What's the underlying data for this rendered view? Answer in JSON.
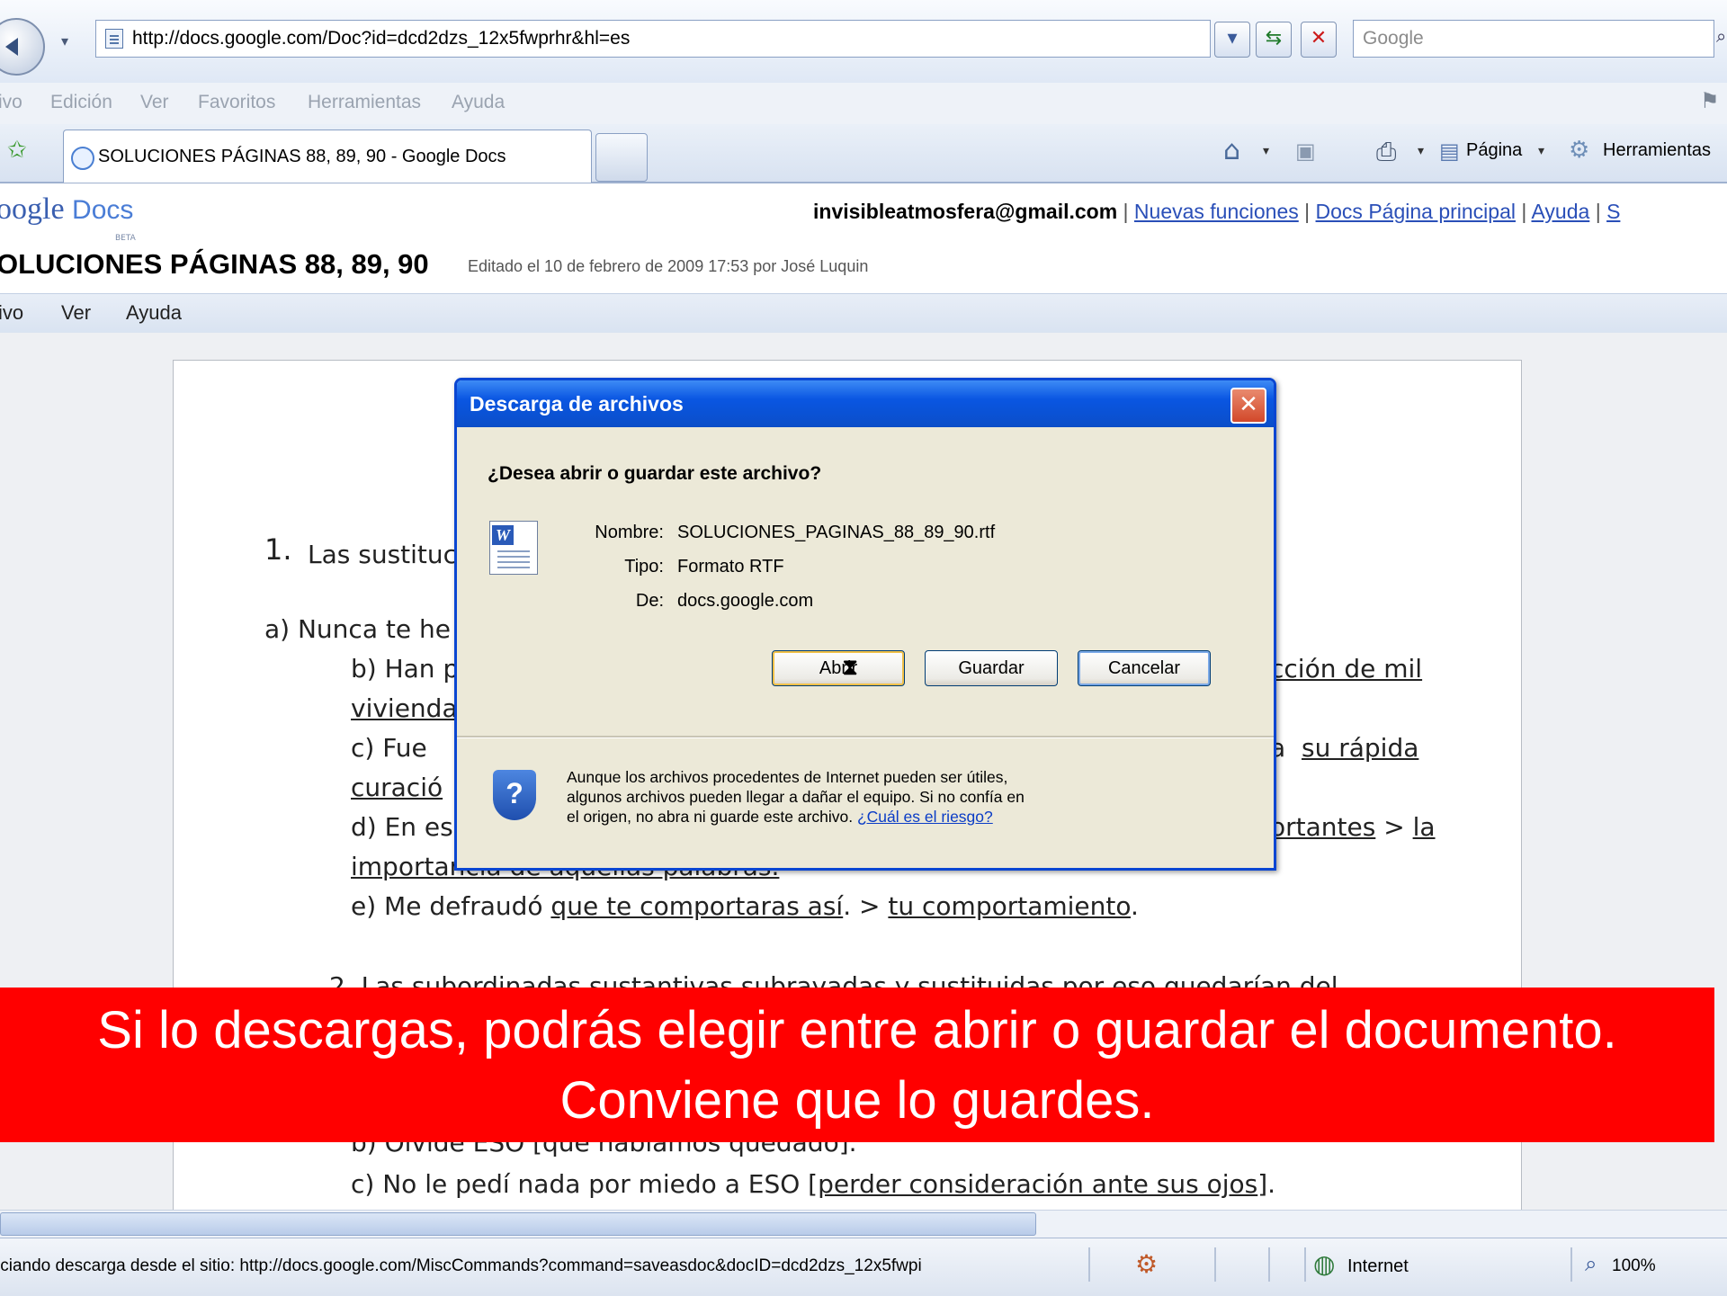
{
  "browser": {
    "url": "http://docs.google.com/Doc?id=dcd2dzs_12x5fwprhr&hl=es",
    "search_placeholder": "Google",
    "menu": [
      "ivo",
      "Edición",
      "Ver",
      "Favoritos",
      "Herramientas",
      "Ayuda"
    ],
    "tab_title": "SOLUCIONES PÁGINAS 88, 89, 90 - Google Docs",
    "commands": {
      "page": "Página",
      "tools": "Herramientas"
    }
  },
  "gdocs": {
    "logo_prefix": "oogle",
    "logo_docs": "Docs",
    "beta": "BETA",
    "email": "invisibleatmosfera@gmail.com",
    "links": [
      "Nuevas funciones",
      "Docs Página principal",
      "Ayuda",
      "S"
    ],
    "doc_title": "OLUCIONES PÁGINAS 88, 89, 90",
    "edited": "Editado el 10 de febrero de 2009 17:53 por José Luquin",
    "doc_menu": [
      "ivo",
      "Ver",
      "Ayuda"
    ]
  },
  "document": {
    "heading_num": "1.",
    "heading_text": "Las sustituc",
    "line_a": "a) Nunca te he",
    "line_b": "b) Han p",
    "line_b_right": "cción de mil",
    "line_b2": "vivienda",
    "line_c": "c) Fue",
    "line_c_right_a": "a",
    "line_c_right_u": "su rápida",
    "line_c2": "curació",
    "line_d": "d) En es",
    "line_d_right_u": "ortantes",
    "line_d_right_gt": " > ",
    "line_d_right_la": "la",
    "line_d2": "importancia de aquellas palabras.",
    "line_e_prefix": "e) Me defraudó ",
    "line_e_u1": "que te comportaras así",
    "line_e_mid": ". > ",
    "line_e_u2": "tu comportamiento",
    "line_e_end": ".",
    "line_2": "2. Las subordinadas sustantivas subrayadas y sustituidas por eso quedarían del",
    "line_b3": "b) Olvide ESO [que habíamos quedado].",
    "line_c3_prefix": "c) No le pedí nada por miedo a ESO [",
    "line_c3_u": "perder consideración ante sus ojos",
    "line_c3_end": "]."
  },
  "dialog": {
    "title": "Descarga de archivos",
    "question": "¿Desea abrir o guardar este archivo?",
    "labels": {
      "name": "Nombre:",
      "type": "Tipo:",
      "from": "De:"
    },
    "file_name": "SOLUCIONES_PAGINAS_88_89_90.rtf",
    "file_type": "Formato RTF",
    "file_from": "docs.google.com",
    "btn_open": "Abrir",
    "btn_save": "Guardar",
    "btn_cancel": "Cancelar",
    "warning_1": "Aunque los archivos procedentes de Internet pueden ser útiles,",
    "warning_2": "algunos archivos pueden llegar a dañar el equipo. Si no confía en",
    "warning_3": "el origen, no abra ni guarde este archivo. ",
    "risk_link": "¿Cuál es el riesgo?"
  },
  "caption": {
    "line1": "Si lo descargas, podrás elegir entre abrir o guardar el documento.",
    "line2": "Conviene que lo guardes."
  },
  "status": {
    "text": "iciando descarga desde el sitio: http://docs.google.com/MiscCommands?command=saveasdoc&docID=dcd2dzs_12x5fwpi",
    "zone": "Internet",
    "zoom": "100%"
  },
  "colors": {
    "caption_bg": "#ff0000",
    "dialog_title": "#0a56e2",
    "link": "#2a4fb8"
  }
}
